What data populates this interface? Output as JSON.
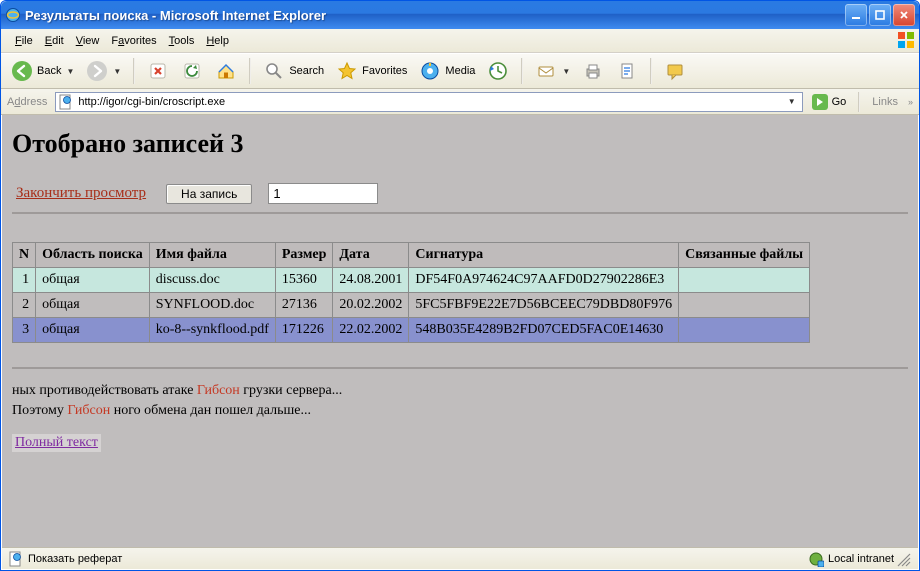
{
  "window": {
    "title": "Результаты поиска - Microsoft Internet Explorer"
  },
  "menu": {
    "file": "File",
    "edit": "Edit",
    "view": "View",
    "favorites": "Favorites",
    "tools": "Tools",
    "help": "Help"
  },
  "toolbar": {
    "back": "Back",
    "search": "Search",
    "favorites": "Favorites",
    "media": "Media"
  },
  "addressbar": {
    "label": "Address",
    "url": "http://igor/cgi-bin/croscript.exe",
    "go": "Go",
    "links": "Links"
  },
  "page": {
    "heading": "Отобрано записей 3",
    "finish_link": "Закончить просмотр",
    "to_record_btn": "На запись",
    "record_input": "1",
    "table": {
      "headers": [
        "N",
        "Область поиска",
        "Имя файла",
        "Размер",
        "Дата",
        "Сигнатура",
        "Связанные файлы"
      ],
      "rows": [
        {
          "n": "1",
          "area": "общая",
          "file": "discuss.doc",
          "size": "15360",
          "date": "24.08.2001",
          "sig": "DF54F0A974624C97AAFD0D27902286E3",
          "linked": ""
        },
        {
          "n": "2",
          "area": "общая",
          "file": "SYNFLOOD.doc",
          "size": "27136",
          "date": "20.02.2002",
          "sig": "5FC5FBF9E22E7D56BCEEC79DBD80F976",
          "linked": ""
        },
        {
          "n": "3",
          "area": "общая",
          "file": "ko-8--synkflood.pdf",
          "size": "171226",
          "date": "22.02.2002",
          "sig": "548B035E4289B2FD07CED5FAC0E14630",
          "linked": ""
        }
      ]
    },
    "snippet_pre1": "ных противодействовать атаке ",
    "snippet_hl": "Гибсон",
    "snippet_post1": " грузки сервера...",
    "snippet_pre2": "Поэтому ",
    "snippet_post2": " ного обмена дан пошел дальше...",
    "full_text_link": "Полный текст"
  },
  "status": {
    "left": "Показать реферат",
    "right": "Local intranet"
  }
}
